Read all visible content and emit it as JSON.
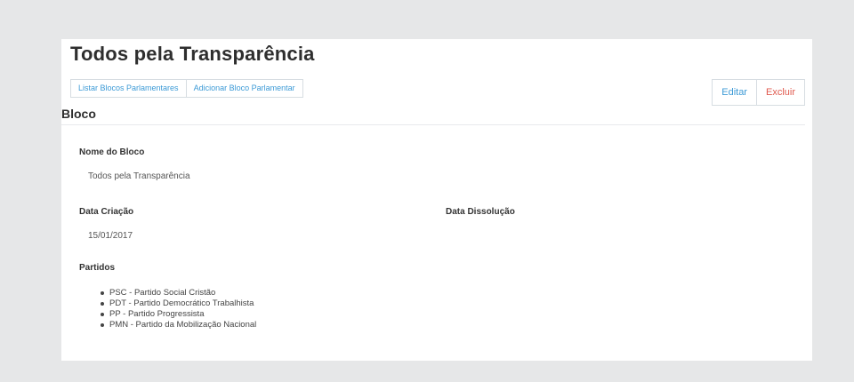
{
  "header": {
    "title": "Todos pela Transparência"
  },
  "nav": {
    "list_label": "Listar Blocos Parlamentares",
    "add_label": "Adicionar Bloco Parlamentar"
  },
  "actions": {
    "edit_label": "Editar",
    "delete_label": "Excluir"
  },
  "section": {
    "title": "Bloco"
  },
  "fields": {
    "name_label": "Nome do Bloco",
    "name_value": "Todos pela Transparência",
    "created_label": "Data Criação",
    "created_value": "15/01/2017",
    "dissolved_label": "Data Dissolução",
    "dissolved_value": ""
  },
  "parties": {
    "label": "Partidos",
    "items": [
      "PSC - Partido Social Cristão",
      "PDT - Partido Democrático Trabalhista",
      "PP - Partido Progressista",
      "PMN - Partido da Mobilização Nacional"
    ]
  },
  "colors": {
    "link": "#3c9ad6",
    "danger": "#e05a4f",
    "background": "#e6e7e8",
    "panel": "#ffffff"
  }
}
